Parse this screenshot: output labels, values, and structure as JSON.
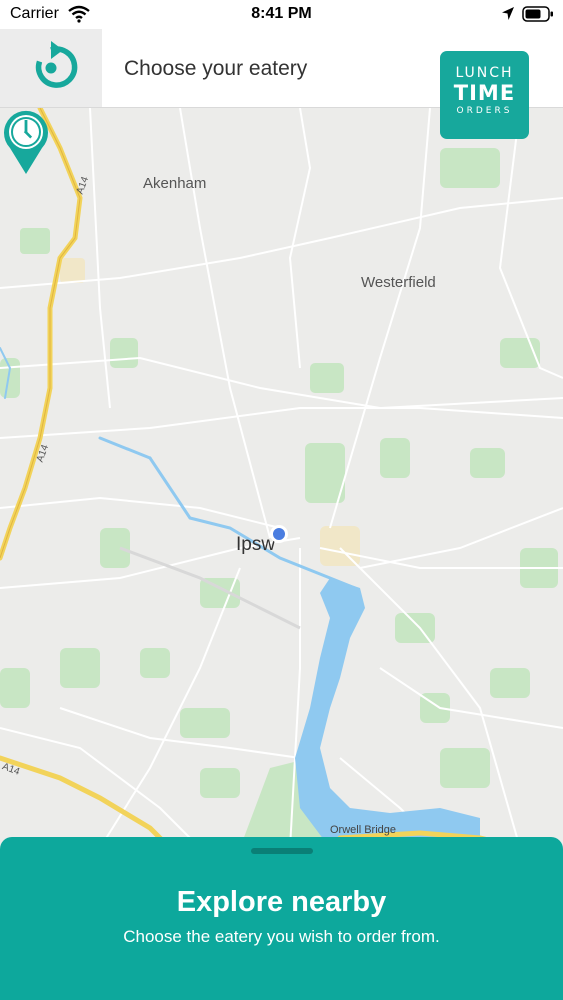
{
  "status_bar": {
    "carrier": "Carrier",
    "time": "8:41 PM"
  },
  "header": {
    "title": "Choose your eatery"
  },
  "logo": {
    "line1": "LUNCH",
    "line2": "TIME",
    "line3": "ORDERS"
  },
  "map": {
    "places": {
      "akenham": "Akenham",
      "westerfield": "Westerfield",
      "ipswich": "Ipsw",
      "orwell_bridge": "Orwell Bridge"
    },
    "roads": {
      "a14_north": "A14",
      "a14_mid": "A14",
      "a14_south": "A14"
    }
  },
  "sheet": {
    "title": "Explore nearby",
    "subtitle": "Choose the eatery you wish to order from."
  },
  "colors": {
    "accent": "#17a89c",
    "sheet": "#0da89c",
    "user_location": "#4a7de0",
    "water": "#8fc9f0",
    "park": "#c8e6c4",
    "motorway": "#f2d35a"
  }
}
